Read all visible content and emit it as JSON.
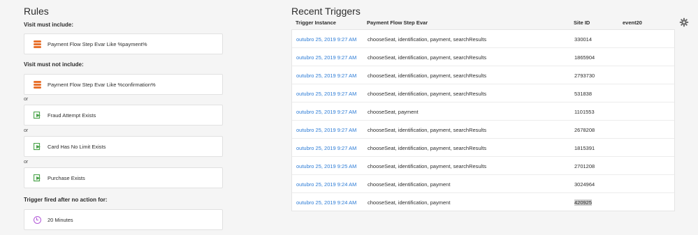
{
  "rules": {
    "title": "Rules",
    "must_include_label": "Visit must include:",
    "must_include": [
      {
        "text": "Payment Flow Step Evar Like %payment%",
        "icon": "evar-icon"
      }
    ],
    "must_not_include_label": "Visit must not include:",
    "must_not_include": [
      {
        "text": "Payment Flow Step Evar Like %confirmation%",
        "icon": "evar-icon"
      },
      {
        "text": "Fraud Attempt Exists",
        "icon": "exists-icon"
      },
      {
        "text": "Card Has No Limit Exists",
        "icon": "exists-icon"
      },
      {
        "text": "Purchase Exists",
        "icon": "exists-icon"
      }
    ],
    "or_label": "or",
    "fired_label": "Trigger fired after no action for:",
    "duration": "20 Minutes"
  },
  "triggers": {
    "title": "Recent Triggers",
    "columns": [
      "Trigger Instance",
      "Payment Flow Step Evar",
      "Site ID",
      "event20"
    ],
    "rows": [
      {
        "time": "outubro 25, 2019 9:27 AM",
        "flow": "chooseSeat, identification, payment, searchResults",
        "site": "330014"
      },
      {
        "time": "outubro 25, 2019 9:27 AM",
        "flow": "chooseSeat, identification, payment, searchResults",
        "site": "1865904"
      },
      {
        "time": "outubro 25, 2019 9:27 AM",
        "flow": "chooseSeat, identification, payment, searchResults",
        "site": "2793730"
      },
      {
        "time": "outubro 25, 2019 9:27 AM",
        "flow": "chooseSeat, identification, payment, searchResults",
        "site": "531838"
      },
      {
        "time": "outubro 25, 2019 9:27 AM",
        "flow": "chooseSeat, payment",
        "site": "1101553"
      },
      {
        "time": "outubro 25, 2019 9:27 AM",
        "flow": "chooseSeat, identification, payment, searchResults",
        "site": "2678208"
      },
      {
        "time": "outubro 25, 2019 9:27 AM",
        "flow": "chooseSeat, identification, payment, searchResults",
        "site": "1815391"
      },
      {
        "time": "outubro 25, 2019 9:25 AM",
        "flow": "chooseSeat, identification, payment, searchResults",
        "site": "2701208"
      },
      {
        "time": "outubro 25, 2019 9:24 AM",
        "flow": "chooseSeat, identification, payment",
        "site": "3024964"
      },
      {
        "time": "outubro 25, 2019 9:24 AM",
        "flow": "chooseSeat, identification, payment",
        "site": "420925",
        "selected": true
      }
    ],
    "settings_icon": "gear-icon"
  },
  "colors": {
    "link": "#2d7cd6",
    "evar_icon": "#e8702a",
    "exists_icon": "#4ca44c",
    "clock_icon": "#b35ad8"
  }
}
